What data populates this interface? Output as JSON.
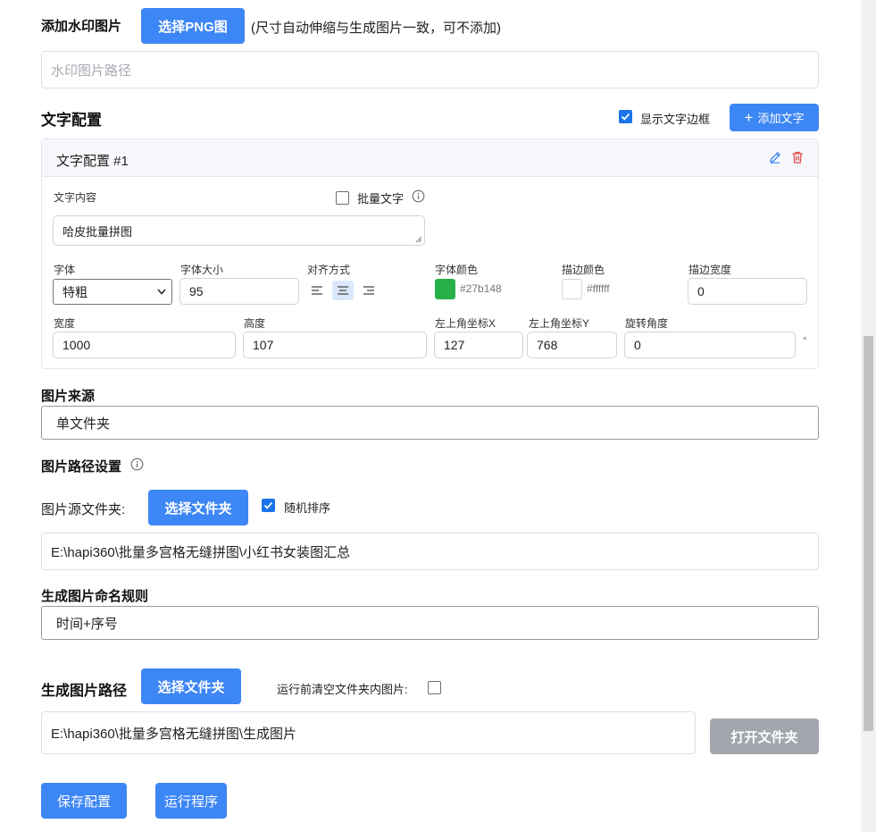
{
  "watermark": {
    "label": "添加水印图片",
    "select_button": "选择PNG图",
    "hint": "(尺寸自动伸缩与生成图片一致，可不添加)",
    "path_placeholder": "水印图片路径"
  },
  "text_config": {
    "title": "文字配置",
    "show_border_label": "显示文字边框",
    "show_border_checked": true,
    "add_button": "添加文字",
    "card": {
      "title": "文字配置 #1",
      "content_label": "文字内容",
      "batch_label": "批量文字",
      "content_value": "哈皮批量拼图",
      "font_label": "字体",
      "font_value": "特粗",
      "size_label": "字体大小",
      "size_value": "95",
      "align_label": "对齐方式",
      "align_selected": "center",
      "color_label": "字体颜色",
      "color_value": "#27b148",
      "stroke_color_label": "描边颜色",
      "stroke_color_value": "#ffffff",
      "stroke_width_label": "描边宽度",
      "stroke_width_value": "0",
      "width_label": "宽度",
      "width_value": "1000",
      "height_label": "高度",
      "height_value": "107",
      "x_label": "左上角坐标X",
      "x_value": "127",
      "y_label": "左上角坐标Y",
      "y_value": "768",
      "rotate_label": "旋转角度",
      "rotate_value": "0",
      "rotate_unit": "°"
    }
  },
  "source": {
    "label": "图片来源",
    "value": "单文件夹"
  },
  "path_settings": {
    "label": "图片路径设置",
    "folder_label": "图片源文件夹:",
    "select_button": "选择文件夹",
    "random_label": "随机排序",
    "random_checked": true,
    "folder_value": "E:\\hapi360\\批量多宫格无缝拼图\\小红书女装图汇总"
  },
  "naming": {
    "label": "生成图片命名规则",
    "value": "时间+序号"
  },
  "output": {
    "label": "生成图片路径",
    "select_button": "选择文件夹",
    "clear_label": "运行前清空文件夹内图片:",
    "clear_checked": false,
    "path_value": "E:\\hapi360\\批量多宫格无缝拼图\\生成图片",
    "open_button": "打开文件夹"
  },
  "footer": {
    "save_button": "保存配置",
    "run_button": "运行程序"
  },
  "colors": {
    "primary": "#3d86f5",
    "font_color": "#27b148",
    "stroke_color": "#ffffff",
    "disabled": "#a2a7ae"
  }
}
